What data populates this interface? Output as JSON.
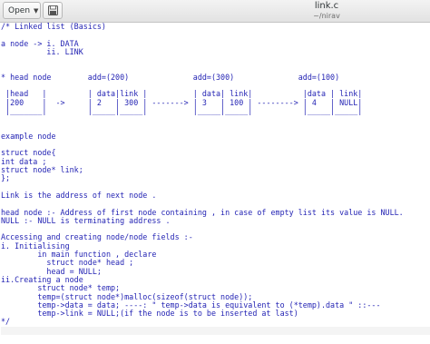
{
  "header": {
    "open_label": "Open",
    "title": "link.c",
    "subtitle": "~/nirav"
  },
  "editor": {
    "lines": [
      "/* Linked list (Basics)",
      "",
      "a node -> i. DATA",
      "          ii. LINK",
      "",
      "",
      "* head node        add=(200)              add=(300)              add=(100)",
      "",
      " |head   |         | data|link |          | data| link|           |data | link|",
      " |200    |  ->     | 2   | 300 | -------> | 3   | 100 | --------> | 4   | NULL|",
      " |_______|         |_____|_____|          |_____|_____|           |_____|_____|",
      "",
      "",
      "example node",
      "",
      "struct node{",
      "int data ;",
      "struct node* link;",
      "};",
      "",
      "Link is the address of next node .",
      "",
      "head node :- Address of first node containing , in case of empty list its value is NULL.",
      "NULL :- NULL is terminating address .",
      "",
      "Accessing and creating node/node fields :-",
      "i. Initialising",
      "        in main function , declare",
      "          struct node* head ;",
      "          head = NULL;",
      "ii.Creating a node",
      "        struct node* temp;",
      "        temp=(struct node*)malloc(sizeof(struct node));",
      "        temp->data = data; ----: \" temp->data is equivalent to (*temp).data \" ::---",
      "        temp->link = NULL;(if the node is to be inserted at last)",
      "*/",
      ""
    ]
  }
}
